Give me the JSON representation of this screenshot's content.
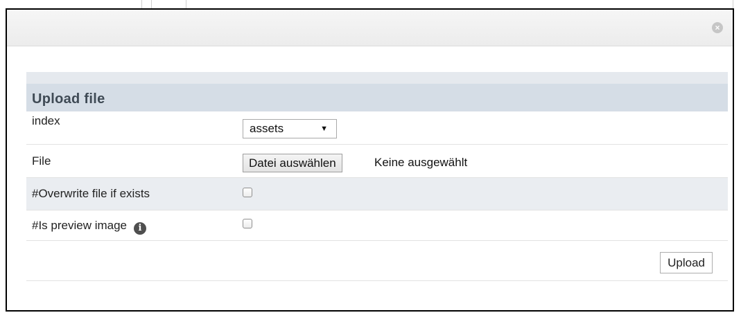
{
  "dialog": {
    "close_icon": "close-circle-icon",
    "close_glyph": "×"
  },
  "form": {
    "title": "Upload file",
    "index": {
      "label": "index",
      "selected": "assets",
      "caret_glyph": "▼"
    },
    "file": {
      "label": "File",
      "button_label": "Datei auswählen",
      "status": "Keine ausgewählt"
    },
    "overwrite": {
      "label": "#Overwrite file if exists",
      "checked": false
    },
    "preview": {
      "label": "#Is preview image",
      "info_icon": "info-icon",
      "info_glyph": "i",
      "checked": false
    },
    "upload_button": "Upload"
  }
}
